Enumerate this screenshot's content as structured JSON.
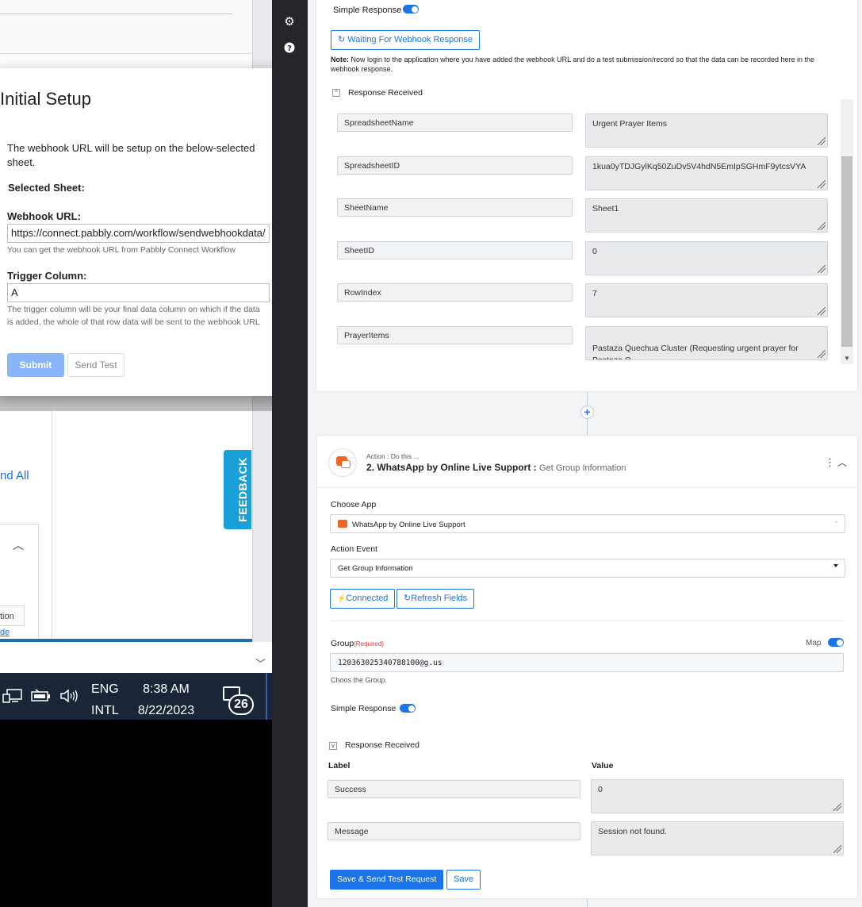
{
  "dialog": {
    "title": "Initial Setup",
    "close_icon": "×",
    "description": "The webhook URL will be setup on the below-selected sheet.",
    "selected_sheet_label": "Selected Sheet:",
    "webhook_label": "Webhook URL:",
    "webhook_value": "https://connect.pabbly.com/workflow/sendwebhookdata/",
    "webhook_hint": "You can get the webhook URL from Pabbly Connect Workflow",
    "trigger_label": "Trigger Column:",
    "trigger_value": "A",
    "trigger_hint": "The trigger column will be your final data column on which if the data is added, the whole of that row data will be sent to the webhook URL",
    "submit_label": "Submit",
    "send_test_label": "Send Test"
  },
  "sheet": {
    "expand_all": "nd All",
    "row1": "tion",
    "row2": "de",
    "feedback": "FEEDBACK"
  },
  "taskbar": {
    "lang_top": "ENG",
    "lang_bottom": "INTL",
    "time": "8:38 AM",
    "date": "8/22/2023",
    "notifications": "26"
  },
  "trigger_card": {
    "simple_response_label": "Simple Response",
    "waiting_button": "Waiting For Webhook Response",
    "note_bold": "Note:",
    "note_text": " Now login to the application where you have added the webhook URL and do a test submission/record so that the data can be recorded here in the webhook response.",
    "response_received": "Response Received",
    "fields": [
      {
        "label": "SpreadsheetName",
        "value": "Urgent Prayer Items"
      },
      {
        "label": "SpreadsheetID",
        "value": "1kua0yTDJGylKq50ZuDv5V4hdN5EmIpSGHmF9ytcsVYA"
      },
      {
        "label": "SheetName",
        "value": "Sheet1"
      },
      {
        "label": "SheetID",
        "value": "0"
      },
      {
        "label": "RowIndex",
        "value": "7"
      },
      {
        "label": "PrayerItems",
        "value": "Pastaza Quechua Cluster (Requesting urgent prayer for Pastaza Q"
      }
    ]
  },
  "action_card": {
    "step_label": "Action : Do this ...",
    "app_title": "2. WhatsApp by Online Live Support :",
    "event_title": "Get Group Information",
    "choose_app_label": "Choose App",
    "choose_app_value": "WhatsApp by Online Live Support",
    "action_event_label": "Action Event",
    "action_event_value": "Get Group Information",
    "connected_button": "Connected",
    "refresh_button": "Refresh Fields",
    "group_label": "Group",
    "group_required": "(Required)",
    "map_label": "Map",
    "group_value": "120363025340788100@g.us",
    "group_hint": "Choos the Group.",
    "simple_response_label": "Simple Response",
    "response_received": "Response Received",
    "label_header": "Label",
    "value_header": "Value",
    "fields": [
      {
        "label": "Success",
        "value": "0"
      },
      {
        "label": "Message",
        "value": "Session not found."
      }
    ],
    "save_send_button": "Save & Send Test Request",
    "save_button": "Save"
  },
  "colors": {
    "accent": "#1a73e8",
    "taskbar": "#1a2538",
    "feedback": "#1aa0d8",
    "brand_orange": "#f26522"
  }
}
